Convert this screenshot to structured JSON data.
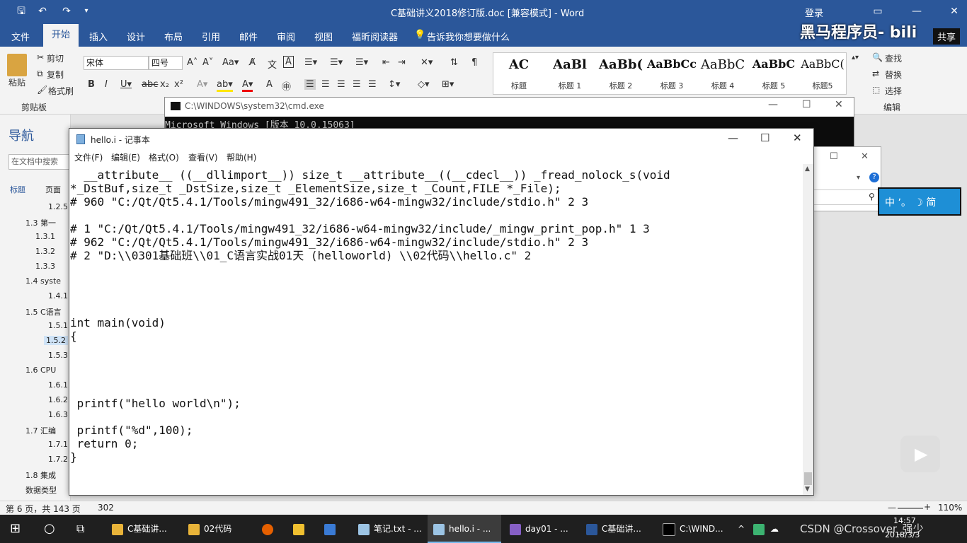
{
  "word": {
    "title": "C基础讲义2018修订版.doc [兼容模式]  -  Word",
    "login": "登录",
    "share": "共享",
    "tabs": [
      "文件",
      "开始",
      "插入",
      "设计",
      "布局",
      "引用",
      "邮件",
      "审阅",
      "视图",
      "福昕阅读器"
    ],
    "tell_me": "告诉我你想要做什么",
    "clipboard": {
      "paste": "粘贴",
      "cut": "剪切",
      "copy": "复制",
      "format_painter": "格式刷",
      "group": "剪贴板"
    },
    "font": {
      "name": "宋体",
      "size": "四号"
    },
    "styles": [
      {
        "preview": "AC",
        "label": "标题"
      },
      {
        "preview": "AaBl",
        "label": "标题 1"
      },
      {
        "preview": "AaBb(",
        "label": "标题 2"
      },
      {
        "preview": "AaBbCc",
        "label": "标题 3"
      },
      {
        "preview": "AaBbC",
        "label": "标题 4"
      },
      {
        "preview": "AaBbC",
        "label": "标题 5"
      },
      {
        "preview": "AaBbC(",
        "label": "标题5"
      }
    ],
    "editing": {
      "find": "查找",
      "replace": "替换",
      "select": "选择",
      "group": "编辑"
    }
  },
  "nav": {
    "title": "导航",
    "search_placeholder": "在文档中搜索",
    "tabs": [
      "标题",
      "页面"
    ],
    "items": [
      "1.2.5",
      "1.3 第一",
      "1.3.1",
      "1.3.2",
      "1.3.3",
      "1.4 syste",
      "1.4.1",
      "1.5 C语言",
      "1.5.1",
      "1.5.2",
      "1.5.3",
      "1.6 CPU",
      "1.6.1",
      "1.6.2",
      "1.6.3",
      "1.7 汇编",
      "1.7.1",
      "1.7.2",
      "1.8 集成",
      "数据类型"
    ]
  },
  "cmd": {
    "title": "C:\\WINDOWS\\system32\\cmd.exe",
    "line": "Microsoft Windows [版本 10.0.15063]"
  },
  "notepad": {
    "title": "hello.i - 记事本",
    "menu": [
      "文件(F)",
      "编辑(E)",
      "格式(O)",
      "查看(V)",
      "帮助(H)"
    ],
    "lines": [
      "  __attribute__ ((__dllimport__)) size_t __attribute__((__cdecl__)) _fread_nolock_s(void",
      "*_DstBuf,size_t _DstSize,size_t _ElementSize,size_t _Count,FILE *_File);",
      "# 960 \"C:/Qt/Qt5.4.1/Tools/mingw491_32/i686-w64-mingw32/include/stdio.h\" 2 3",
      "",
      "# 1 \"C:/Qt/Qt5.4.1/Tools/mingw491_32/i686-w64-mingw32/include/_mingw_print_pop.h\" 1 3",
      "# 962 \"C:/Qt/Qt5.4.1/Tools/mingw491_32/i686-w64-mingw32/include/stdio.h\" 2 3",
      "# 2 \"D:\\\\0301基础班\\\\01_C语言实战01天 (helloworld) \\\\02代码\\\\hello.c\" 2",
      "",
      "",
      "",
      "",
      "int main(void)",
      "{",
      "",
      "",
      "",
      "",
      " printf(\"hello world\\n\");",
      "",
      " printf(\"%d\",100);",
      " return 0;",
      "}"
    ]
  },
  "ime": "中 ʼ。 ☽ 简",
  "watermark": "黑马程序员- bili",
  "status": {
    "page": "第 6 页，共 143 页",
    "words": "302",
    "zoom": "110%"
  },
  "taskbar": {
    "items": [
      "C基础讲...",
      "02代码",
      "",
      "",
      "",
      "笔记.txt - ...",
      "hello.i - ...",
      "day01 - ...",
      "C基础讲...",
      "C:\\WIND..."
    ],
    "time": "14:57",
    "date": "2018/3/3",
    "overlay": "CSDN @Crossover_强少"
  }
}
